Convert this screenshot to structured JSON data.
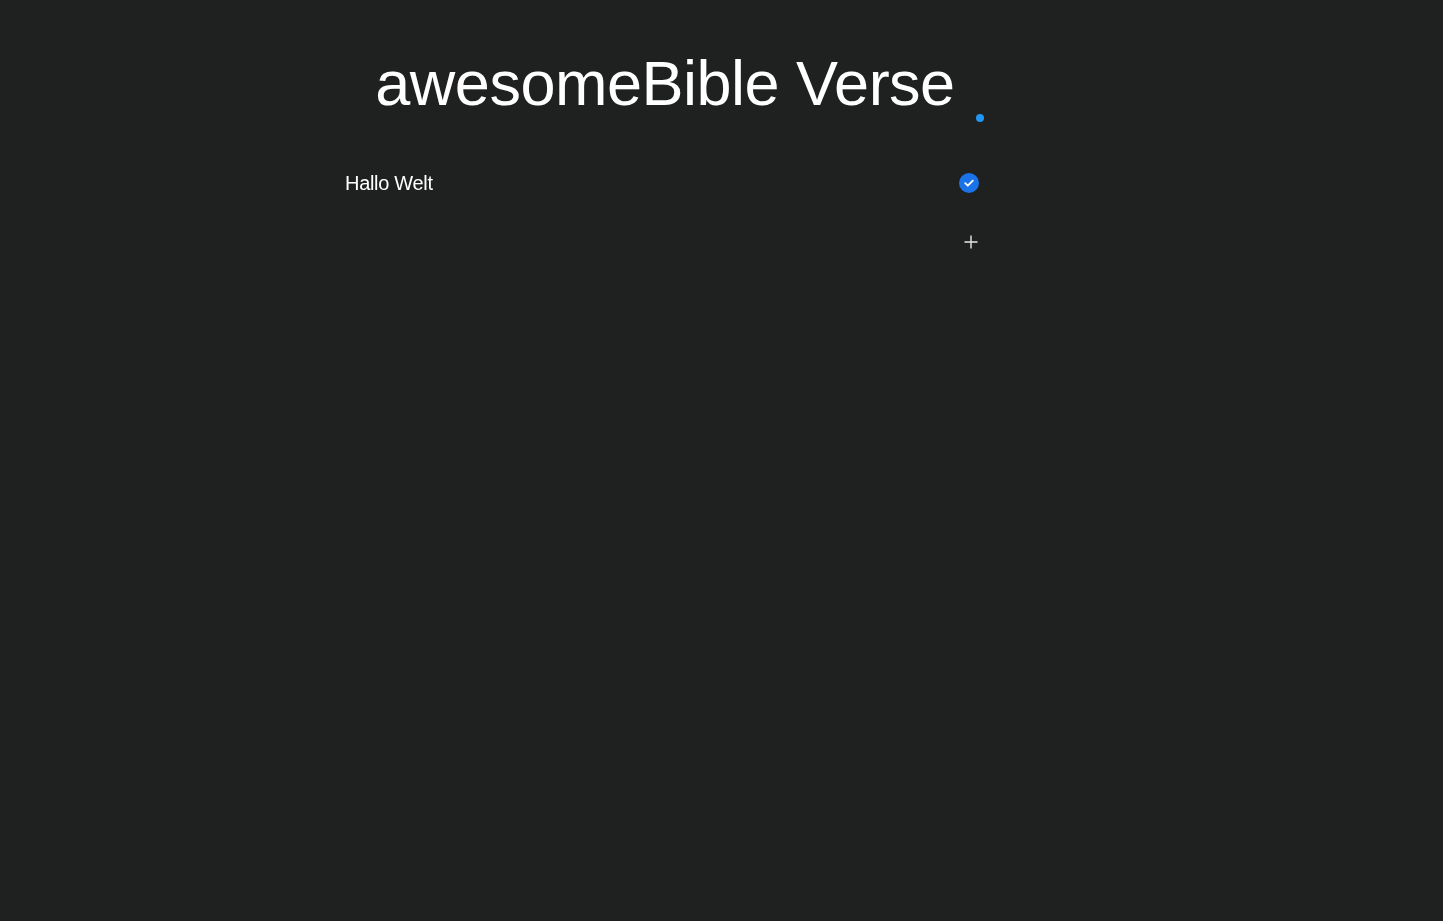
{
  "title": "awesomeBible Verse",
  "todos": [
    {
      "text": "Hallo Welt",
      "checked": true
    }
  ]
}
